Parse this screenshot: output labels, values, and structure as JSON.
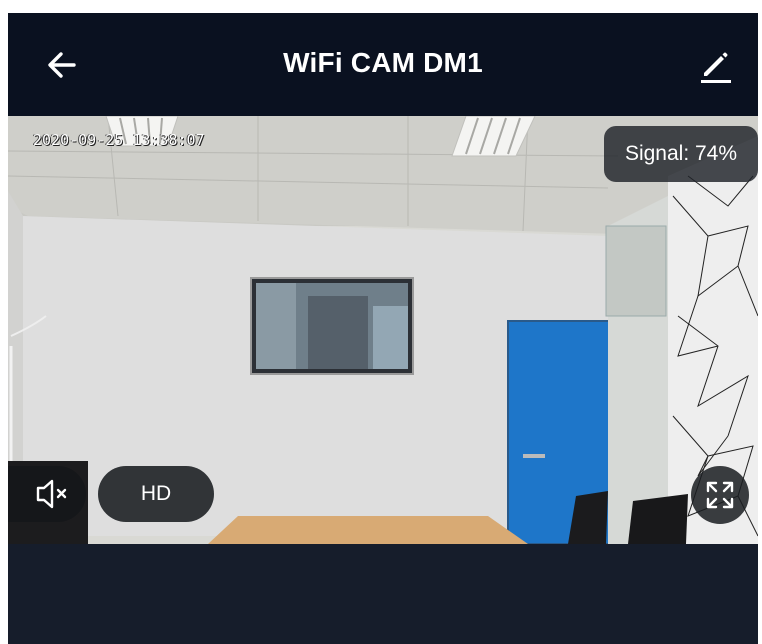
{
  "header": {
    "title": "WiFi CAM DM1",
    "back_icon": "arrow-left-icon",
    "edit_icon": "pencil-icon"
  },
  "video": {
    "timestamp": "2020-09-25 13:38:07",
    "signal_text": "Signal: 74%",
    "quality_label": "HD",
    "mute_icon": "speaker-muted-icon",
    "fullscreen_icon": "fullscreen-icon"
  },
  "colors": {
    "header_bg": "#0a1120",
    "content_bg": "#141c2b",
    "overlay_bg": "#1e2228",
    "text": "#ffffff"
  }
}
